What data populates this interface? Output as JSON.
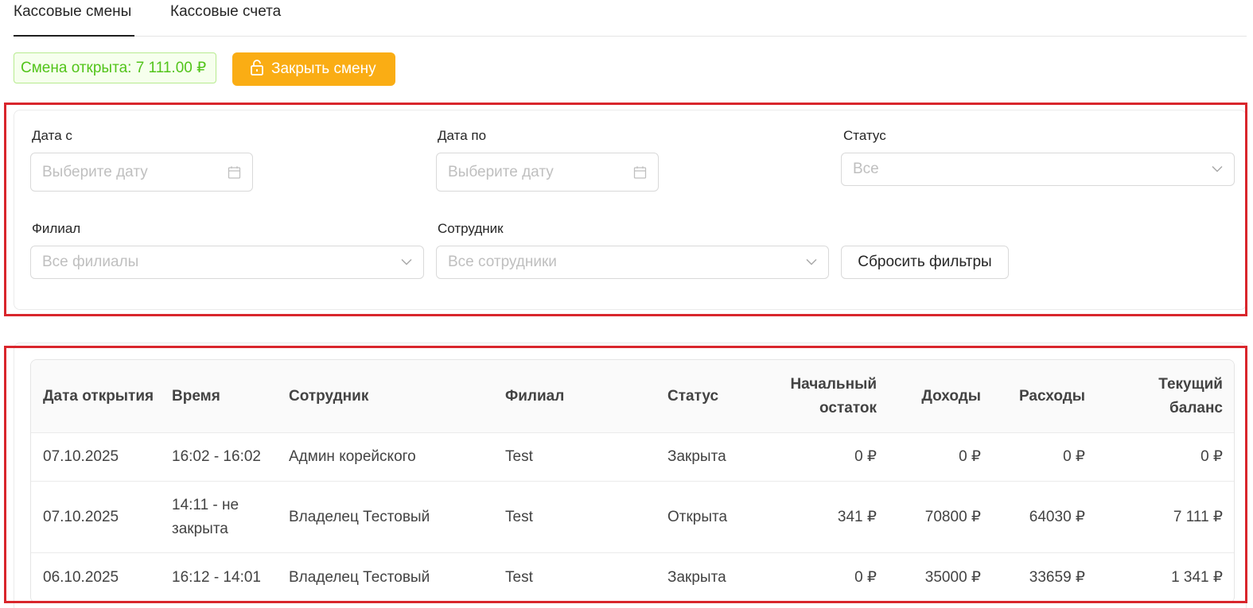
{
  "tabs": [
    {
      "label": "Кассовые смены",
      "active": true
    },
    {
      "label": "Кассовые счета",
      "active": false
    }
  ],
  "shift": {
    "badge_text": "Смена открыта: 7 111.00 ₽",
    "close_button_label": "Закрыть смену"
  },
  "filters": {
    "date_from": {
      "label": "Дата с",
      "placeholder": "Выберите дату"
    },
    "date_to": {
      "label": "Дата по",
      "placeholder": "Выберите дату"
    },
    "status": {
      "label": "Статус",
      "value": "Все"
    },
    "branch": {
      "label": "Филиал",
      "value": "Все филиалы"
    },
    "employee": {
      "label": "Сотрудник",
      "value": "Все сотрудники"
    },
    "reset_label": "Сбросить фильтры"
  },
  "table": {
    "columns": [
      "Дата открытия",
      "Время",
      "Сотрудник",
      "Филиал",
      "Статус",
      "Начальный остаток",
      "Доходы",
      "Расходы",
      "Текущий баланс"
    ],
    "rows": [
      [
        "07.10.2025",
        "16:02 - 16:02",
        "Админ корейского",
        "Test",
        "Закрыта",
        "0 ₽",
        "0 ₽",
        "0 ₽",
        "0 ₽"
      ],
      [
        "07.10.2025",
        "14:11 - не закрыта",
        "Владелец Тестовый",
        "Test",
        "Открыта",
        "341 ₽",
        "70800 ₽",
        "64030 ₽",
        "7 111 ₽"
      ],
      [
        "06.10.2025",
        "16:12 - 14:01",
        "Владелец Тестовый",
        "Test",
        "Закрыта",
        "0 ₽",
        "35000 ₽",
        "33659 ₽",
        "1 341 ₽"
      ]
    ]
  },
  "colors": {
    "accent_orange": "#faad14",
    "success_green": "#52c41a",
    "highlight_red": "#d9262c"
  }
}
